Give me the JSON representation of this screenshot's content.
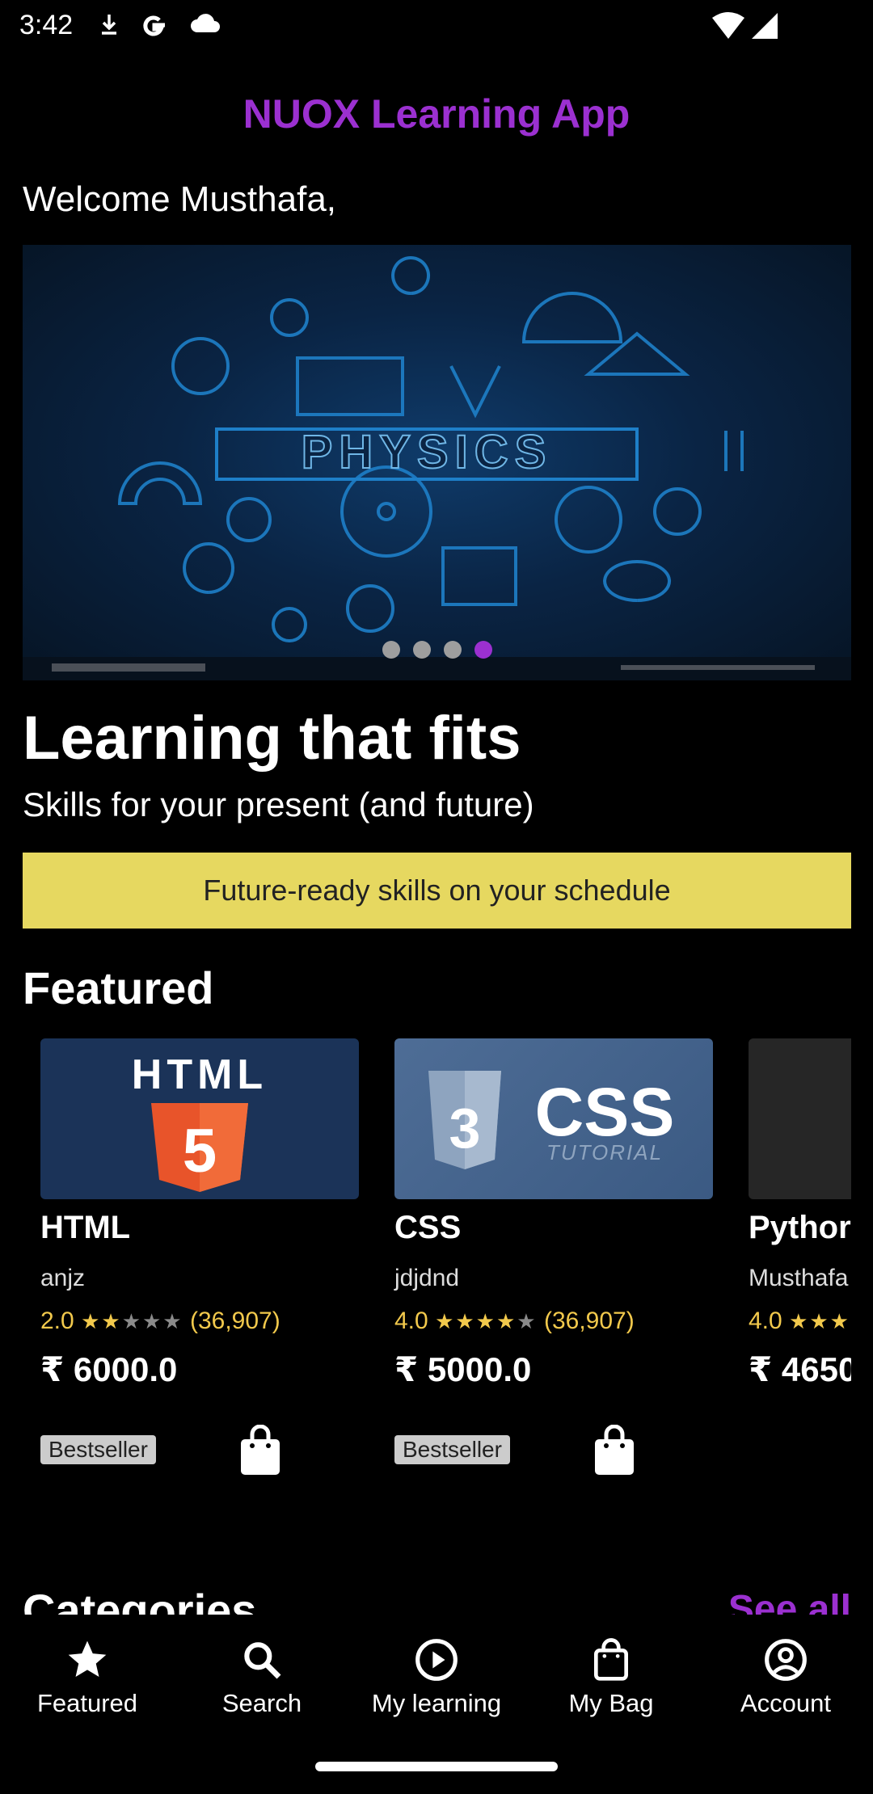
{
  "status_bar": {
    "time": "3:42",
    "icons": [
      "download-icon",
      "google-icon",
      "cloud-icon",
      "wifi-icon",
      "signal-icon"
    ]
  },
  "app": {
    "title": "NUOX Learning App",
    "title_color": "#9b30d0"
  },
  "welcome": "Welcome Musthafa,",
  "carousel": {
    "page_count": 4,
    "active_index": 3,
    "image": "physics-banner"
  },
  "banner": {
    "title": "Learning that fits",
    "subtitle": "Skills for your present (and future)",
    "promo": "Future-ready skills on your schedule",
    "promo_color": "#e6d860"
  },
  "featured": {
    "title": "Featured",
    "courses": [
      {
        "title": "HTML",
        "author": "anjz",
        "rating": "2.0",
        "rating_value": 2,
        "reviews": "(36,907)",
        "price": "₹ 6000.0",
        "badge": "Bestseller"
      },
      {
        "title": "CSS",
        "author": "jdjdnd",
        "rating": "4.0",
        "rating_value": 4,
        "reviews": "(36,907)",
        "price": "₹ 5000.0",
        "badge": "Bestseller"
      },
      {
        "title": "Pythor",
        "author": "Musthafa",
        "rating": "4.0",
        "rating_value": 4,
        "reviews": "",
        "price": "₹ 4650",
        "badge": ""
      }
    ]
  },
  "categories": {
    "title": "Categories",
    "see_all": "See all"
  },
  "bottom_nav": {
    "items": [
      {
        "label": "Featured",
        "icon": "star-icon"
      },
      {
        "label": "Search",
        "icon": "search-icon"
      },
      {
        "label": "My learning",
        "icon": "play-circle-icon"
      },
      {
        "label": "My Bag",
        "icon": "bag-icon"
      },
      {
        "label": "Account",
        "icon": "account-icon"
      }
    ]
  }
}
